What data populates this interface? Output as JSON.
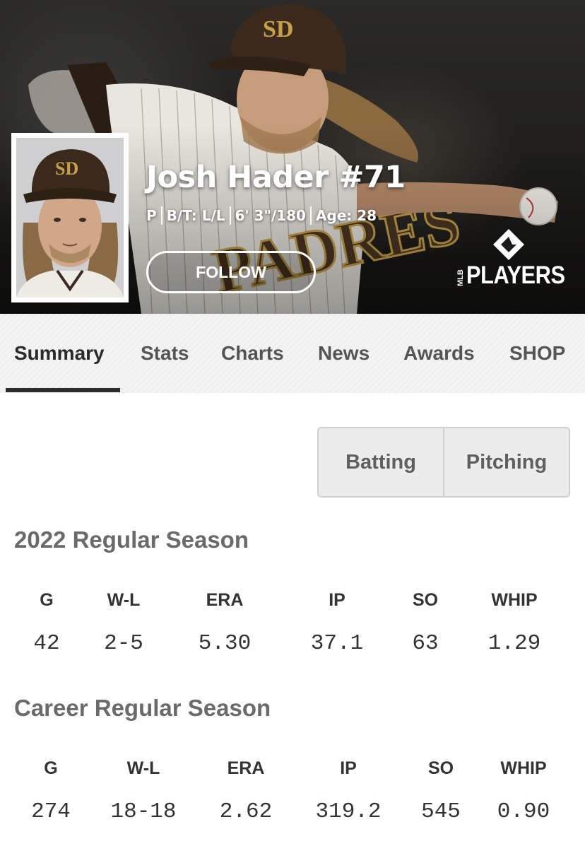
{
  "player": {
    "name": "Josh Hader #71",
    "position": "P",
    "bats_throws": "B/T: L/L",
    "height_weight": "6' 3\"/180",
    "age": "Age: 28",
    "follow_label": "FOLLOW",
    "team_colors": {
      "brown": "#3b2a1c",
      "gold": "#c7a04c"
    }
  },
  "brand": {
    "mlb": "MLB",
    "players": "PLAYERS",
    "icon": "mlbpa-logo-icon"
  },
  "tabs": [
    {
      "label": "Summary",
      "active": true
    },
    {
      "label": "Stats",
      "active": false
    },
    {
      "label": "Charts",
      "active": false
    },
    {
      "label": "News",
      "active": false
    },
    {
      "label": "Awards",
      "active": false
    },
    {
      "label": "SHOP",
      "active": false
    }
  ],
  "toggle": {
    "options": [
      "Batting",
      "Pitching"
    ]
  },
  "stats": {
    "headers": [
      "G",
      "W-L",
      "ERA",
      "IP",
      "SO",
      "WHIP"
    ],
    "season": {
      "title": "2022 Regular Season",
      "values": [
        "42",
        "2-5",
        "5.30",
        "37.1",
        "63",
        "1.29"
      ]
    },
    "career": {
      "title": "Career Regular Season",
      "values": [
        "274",
        "18-18",
        "2.62",
        "319.2",
        "545",
        "0.90"
      ]
    }
  },
  "colors": {
    "accent": "#2b2b2b",
    "tab_bg": "#f3f3f3",
    "muted_text": "#6a6a6a"
  }
}
